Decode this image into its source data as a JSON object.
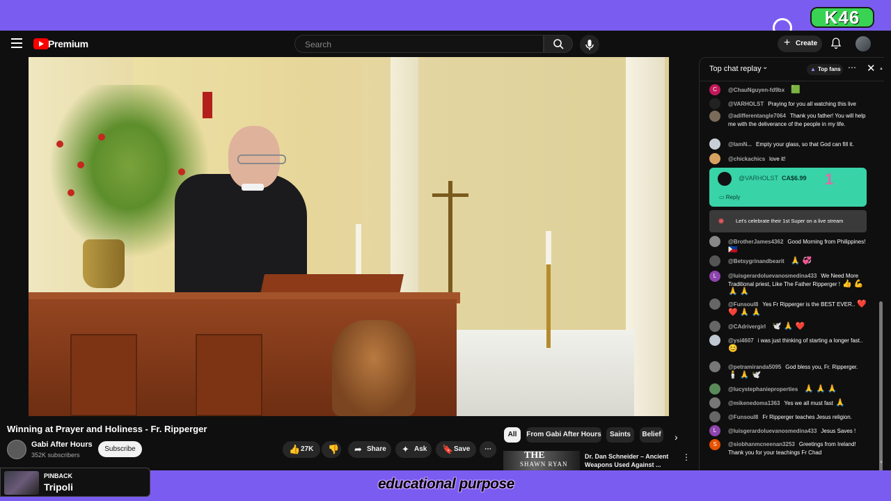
{
  "overlay": {
    "badge": "K46",
    "caption": "educational purpose",
    "pinback_label": "PINBACK",
    "pinback_title": "Tripoli"
  },
  "masthead": {
    "brand": "Premium",
    "search_placeholder": "Search",
    "create_label": "Create",
    "icons": [
      "menu-icon",
      "youtube-logo-icon",
      "search-icon",
      "mic-icon",
      "plus-icon",
      "bell-icon",
      "avatar"
    ]
  },
  "video": {
    "title": "Winning at Prayer and Holiness - Fr. Ripperger",
    "channel": "Gabi After Hours",
    "subscribers": "352K subscribers",
    "subscribe_label": "Subscribe",
    "likes": "27K",
    "share_label": "Share",
    "ask_label": "Ask",
    "save_label": "Save"
  },
  "chips": [
    "All",
    "From Gabi After Hours",
    "Saints",
    "Belief"
  ],
  "recommended": {
    "thumb_text": "THE",
    "thumb_sub": "SHAWN RYAN",
    "title": "Dr. Dan Schneider – Ancient Weapons Used Against ..."
  },
  "chat": {
    "title": "Top chat replay",
    "top_fans": "Top fans",
    "messages": [
      {
        "initial": "C",
        "color": "#c2185b",
        "author": "@ChauNguyen-fd9bx",
        "text": "",
        "emoji": "🟩"
      },
      {
        "initial": "",
        "color": "#222",
        "author": "@VARHOLST",
        "text": "Praying for you all watching this live",
        "emoji": ""
      },
      {
        "initial": "",
        "color": "#7a6a5a",
        "author": "@adifferentangle7064",
        "text": "Thank you father! You will help me with the deliverance of the people in my life.",
        "emoji": ""
      },
      {
        "initial": "",
        "color": "#c9ced6",
        "author": "@IamN...",
        "text": "Empty your glass, so that God can fill it.",
        "emoji": ""
      },
      {
        "initial": "",
        "color": "#d8a060",
        "author": "@chickachics",
        "text": "love it!",
        "emoji": ""
      },
      {
        "initial": "",
        "color": "#888",
        "author": "@BrotherJames4362",
        "text": "Good Morning from Philippines!",
        "emoji": "🇵🇭"
      },
      {
        "initial": "",
        "color": "#555",
        "author": "@Betsygrinandbearit",
        "text": "",
        "emoji": "🙏 💞"
      },
      {
        "initial": "L",
        "color": "#8e44ad",
        "author": "@luisgerardoluevanosmedina433",
        "text": "We Need More Traditional priest, Like The Father Ripperger !",
        "emoji": "👍 💪 🙏 🙏"
      },
      {
        "initial": "",
        "color": "#666",
        "author": "@Funsoul8",
        "text": "Yes Fr Ripperger is the BEST EVER..",
        "emoji": "❤️ ❤️ 🙏 🙏"
      },
      {
        "initial": "",
        "color": "#666",
        "author": "@CAdrivergirl",
        "text": "",
        "emoji": "🕊️ 🙏 ❤️"
      },
      {
        "initial": "",
        "color": "#bfc7d0",
        "author": "@ysi4607",
        "text": "i was just thinking of starting a longer fast..",
        "emoji": "😊"
      },
      {
        "initial": "",
        "color": "#777",
        "author": "@petramiranda5095",
        "text": "God bless you, Fr. Ripperger.",
        "emoji": "🕯️ 🙏 🕊️"
      },
      {
        "initial": "",
        "color": "#5a8a5a",
        "author": "@lucystephanieproperties",
        "text": "",
        "emoji": "🙏 🙏 🙏"
      },
      {
        "initial": "",
        "color": "#777",
        "author": "@mikenedoma1363",
        "text": "Yes we all must fast",
        "emoji": "🙏"
      },
      {
        "initial": "",
        "color": "#666",
        "author": "@Funsoul8",
        "text": "Fr Ripperger teaches Jesus religion.",
        "emoji": ""
      },
      {
        "initial": "L",
        "color": "#8e44ad",
        "author": "@luisgerardoluevanosmedina433",
        "text": "Jesus Saves !",
        "emoji": ""
      },
      {
        "initial": "S",
        "color": "#e65100",
        "author": "@siobhanmcneenan3253",
        "text": "Greetings from Ireland! Thank you for your teachings Fr Chad",
        "emoji": ""
      }
    ],
    "super_chat": {
      "author": "@VARHOLST",
      "amount": "CA$6.99",
      "sticker": "1",
      "reply_label": "Reply"
    },
    "celebration": "Let's celebrate their 1st Super on a live stream"
  }
}
